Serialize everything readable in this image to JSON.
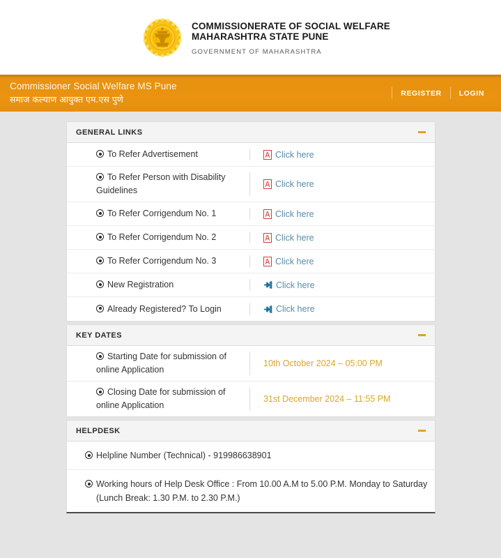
{
  "header": {
    "emblem_icon": "maharashtra-state-emblem",
    "org_title": "COMMISSIONERATE OF SOCIAL WELFARE\nMAHARASHTRA STATE PUNE",
    "org_subtitle": "GOVERNMENT OF MAHARASHTRA"
  },
  "navbar": {
    "brand_en": "Commissioner Social Welfare MS Pune",
    "brand_mr": "समाज कल्याण आयुक्त एम.एस पुणे",
    "register_label": "REGISTER",
    "login_label": "LOGIN",
    "background_color": "#ea9310"
  },
  "panels": {
    "general_links": {
      "title": "GENERAL LINKS",
      "collapse_icon": "minus-icon",
      "rows": [
        {
          "label": "To Refer Advertisement",
          "icon": "pdf-icon",
          "link": "Click here"
        },
        {
          "label": "To Refer Person with Disability Guidelines",
          "icon": "pdf-icon",
          "link": "Click here"
        },
        {
          "label": "To Refer Corrigendum No. 1",
          "icon": "pdf-icon",
          "link": "Click here"
        },
        {
          "label": "To Refer Corrigendum No. 2",
          "icon": "pdf-icon",
          "link": "Click here"
        },
        {
          "label": "To Refer Corrigendum No. 3",
          "icon": "pdf-icon",
          "link": "Click here"
        },
        {
          "label": "New Registration",
          "icon": "sign-in-icon",
          "link": "Click here"
        },
        {
          "label": "Already Registered? To Login",
          "icon": "sign-in-icon",
          "link": "Click here"
        }
      ]
    },
    "key_dates": {
      "title": "KEY DATES",
      "collapse_icon": "minus-icon",
      "value_color": "#d8a727",
      "rows": [
        {
          "label": "Starting Date for submission of online Application",
          "value": "10th October 2024 – 05:00 PM"
        },
        {
          "label": "Closing Date for submission of online Application",
          "value": "31st December 2024 – 11:55 PM"
        }
      ]
    },
    "helpdesk": {
      "title": "HELPDESK",
      "collapse_icon": "minus-icon",
      "rows": [
        {
          "text": "Helpline Number (Technical) - 919986638901"
        },
        {
          "text": "Working hours of Help Desk Office : From 10.00 A.M to 5.00 P.M. Monday to Saturday (Lunch Break: 1.30 P.M. to 2.30 P.M.)"
        }
      ]
    }
  }
}
